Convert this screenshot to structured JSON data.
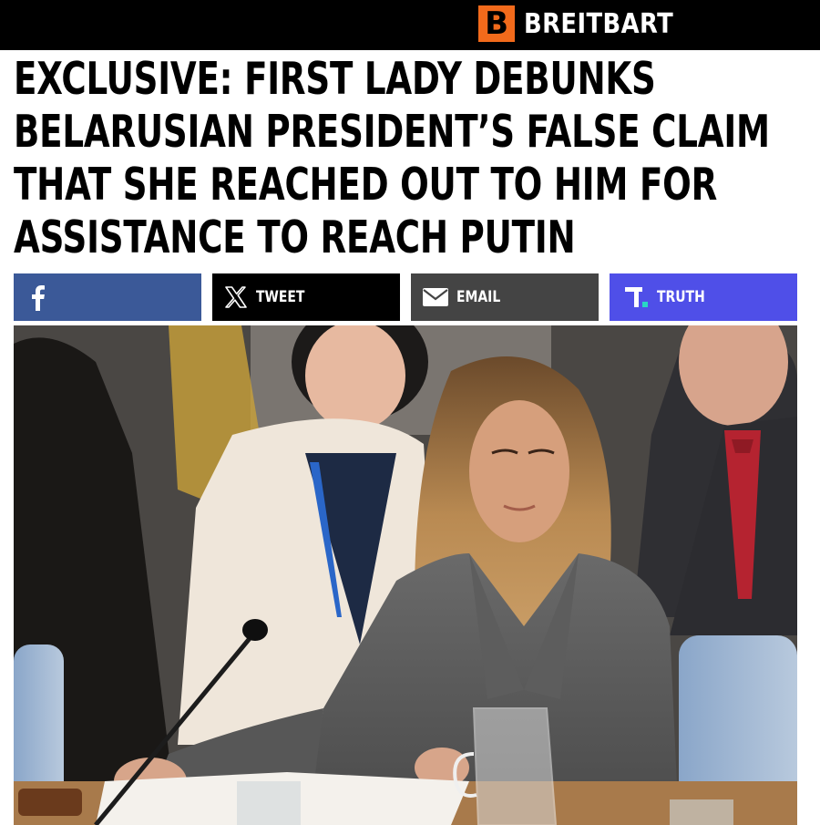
{
  "header": {
    "logo_letter": "B",
    "site_name": "BREITBART"
  },
  "headline_lines": [
    "EXCLUSIVE: FIRST LADY DEBUNKS",
    "BELARUSIAN PRESIDENT’S FALSE CLAIM",
    "THAT SHE REACHED OUT TO HIM FOR",
    "ASSISTANCE TO REACH PUTIN"
  ],
  "share": {
    "facebook_icon": "facebook-icon",
    "tweet_label": "TWEET",
    "email_label": "EMAIL",
    "truth_label": "TRUTH"
  },
  "colors": {
    "brand_orange": "#f26a1b",
    "facebook_blue": "#3b5998",
    "email_gray": "#444444",
    "truth_purple": "#4f4fe8"
  }
}
